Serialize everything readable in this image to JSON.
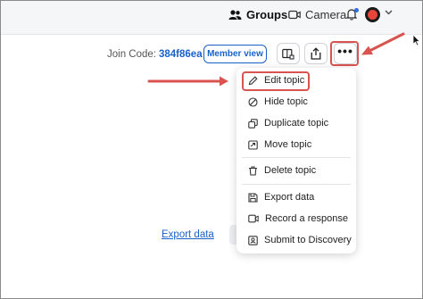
{
  "header": {
    "groups_label": "Groups",
    "camera_label": "Camera"
  },
  "toolbar": {
    "join_label": "Join Code:",
    "join_code": "384f86ea",
    "member_view_label": "Member view",
    "more_label": "•••"
  },
  "menu": {
    "edit": "Edit topic",
    "hide": "Hide topic",
    "duplicate": "Duplicate topic",
    "move": "Move topic",
    "delete": "Delete topic",
    "export": "Export data",
    "record": "Record a response",
    "submit": "Submit to Discovery"
  },
  "main": {
    "export_link": "Export data"
  },
  "colors": {
    "accent": "#1a62c9",
    "annotation": "#d9534f",
    "notification": "#2f6be6"
  },
  "icons": [
    "groups-icon",
    "camera-icon",
    "bell-icon",
    "avatar",
    "chevron-down-icon",
    "screen-share-icon",
    "share-icon",
    "more-icon",
    "pencil-icon",
    "hide-icon",
    "duplicate-icon",
    "move-icon",
    "trash-icon",
    "save-icon",
    "record-icon",
    "discovery-icon"
  ]
}
